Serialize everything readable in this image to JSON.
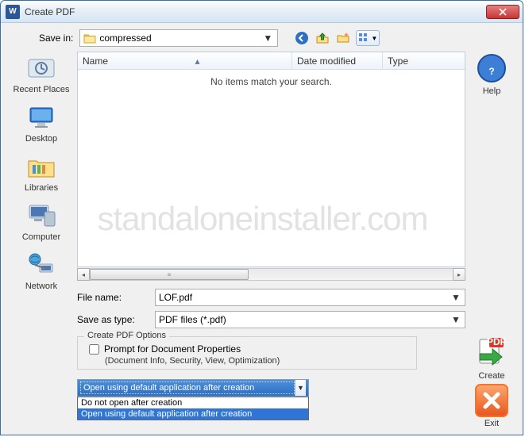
{
  "window": {
    "title": "Create PDF"
  },
  "toolbar": {
    "savein_label": "Save in:",
    "folder_name": "compressed"
  },
  "nav_icons": {
    "back": "back-icon",
    "up": "up-icon",
    "newfolder": "new-folder-icon",
    "views": "views-icon"
  },
  "places": {
    "recent": "Recent Places",
    "desktop": "Desktop",
    "libraries": "Libraries",
    "computer": "Computer",
    "network": "Network"
  },
  "listview": {
    "col_name": "Name",
    "col_date": "Date modified",
    "col_type": "Type",
    "empty_msg": "No items match your search."
  },
  "filename_label": "File name:",
  "filename_value": "LOF.pdf",
  "savetype_label": "Save as type:",
  "savetype_value": "PDF files (*.pdf)",
  "options": {
    "legend": "Create PDF Options",
    "prompt_label": "Prompt for Document Properties",
    "prompt_hint": "(Document Info, Security, View, Optimization)"
  },
  "after_create": {
    "selected": "Open using default application after creation",
    "opt_none": "Do not open after creation",
    "opt_default": "Open using default application after creation"
  },
  "rail": {
    "help": "Help",
    "create": "Create",
    "exit": "Exit"
  },
  "watermark": "standaloneinstaller.com"
}
